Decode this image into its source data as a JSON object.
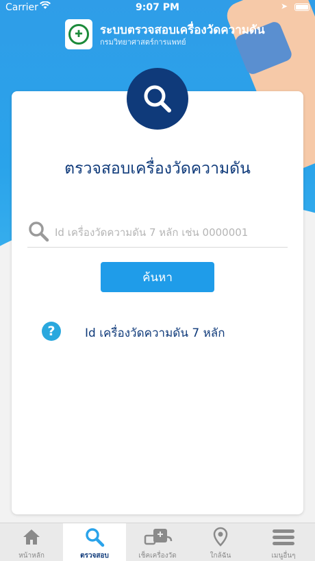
{
  "status_bar": {
    "carrier": "Carrier",
    "time": "9:07 PM"
  },
  "header": {
    "title": "ระบบตรวจสอบเครื่องวัดความดัน",
    "subtitle": "กรมวิทยาศาสตร์การแพทย์"
  },
  "card": {
    "title": "ตรวจสอบเครื่องวัดความดัน",
    "search_placeholder": "Id เครื่องวัดความดัน 7 หลัก เช่น 0000001",
    "search_value": "",
    "search_button": "ค้นหา",
    "help_text": "Id เครื่องวัดความดัน 7 หลัก"
  },
  "tabs": [
    {
      "label": "หน้าหลัก",
      "icon": "home-icon",
      "active": false
    },
    {
      "label": "ตรวจสอบ",
      "icon": "search-icon",
      "active": true
    },
    {
      "label": "เช็คเครื่องวัด",
      "icon": "bp-monitor-icon",
      "active": false
    },
    {
      "label": "ใกล้ฉัน",
      "icon": "location-pin-icon",
      "active": false
    },
    {
      "label": "เมนูอื่นๆ",
      "icon": "menu-icon",
      "active": false
    }
  ],
  "colors": {
    "primary_blue": "#2f9de8",
    "navy": "#0f3a7a",
    "button_blue": "#1f9ce9",
    "help_icon": "#2aa8de"
  }
}
